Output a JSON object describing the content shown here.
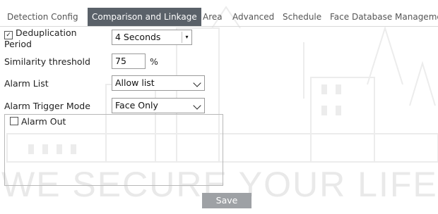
{
  "tabs": [
    {
      "label": "Detection Config"
    },
    {
      "label": "Comparison and Linkage"
    },
    {
      "label": "Area"
    },
    {
      "label": "Advanced"
    },
    {
      "label": "Schedule"
    },
    {
      "label": "Face Database Management"
    }
  ],
  "active_tab": "Comparison and Linkage",
  "form": {
    "dedup": {
      "label": "Deduplication Period",
      "checked": true,
      "value": "4 Seconds"
    },
    "similarity": {
      "label": "Similarity threshold",
      "value": "75",
      "unit": "%"
    },
    "alarm_list": {
      "label": "Alarm List",
      "value": "Allow list"
    },
    "trigger_mode": {
      "label": "Alarm Trigger Mode",
      "value": "Face Only"
    },
    "alarm_out": {
      "label": "Alarm Out",
      "checked": false
    }
  },
  "save_label": "Save",
  "watermark": "WE SECURE YOUR LIFE",
  "colors": {
    "active_tab_bg": "#5a6169",
    "button_bg": "#9ea1a5",
    "watermark": "#e9e9e9"
  }
}
